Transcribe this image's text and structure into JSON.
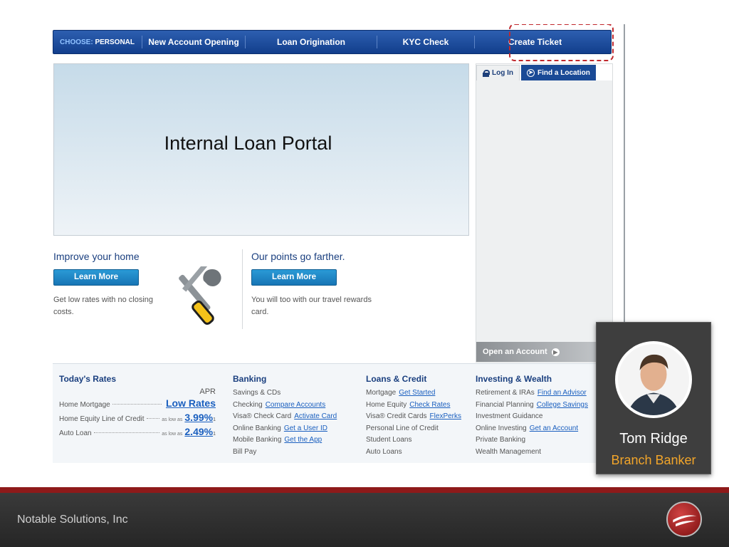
{
  "nav": {
    "choose_label": "CHOOSE:",
    "choose_value": "PERSONAL",
    "items": [
      "New Account Opening",
      "Loan Origination",
      "KYC Check",
      "Create Ticket"
    ]
  },
  "hero": {
    "title": "Internal Loan Portal"
  },
  "side": {
    "tab_login": "Log In",
    "tab_find": "Find a Location",
    "open_account": "Open an Account"
  },
  "promos": [
    {
      "title": "Improve your home",
      "button": "Learn More",
      "text": "Get low rates with no closing costs."
    },
    {
      "title": "Our points go farther.",
      "button": "Learn More",
      "text": "You will too with our travel rewards card."
    }
  ],
  "rates": {
    "title": "Today's Rates",
    "apr_label": "APR",
    "rows": [
      {
        "label": "Home Mortgage",
        "as_low_as": "",
        "value": "Low Rates",
        "sup": ""
      },
      {
        "label": "Home Equity Line of Credit",
        "as_low_as": "as low as",
        "value": "3.99%",
        "sup": "1"
      },
      {
        "label": "Auto Loan",
        "as_low_as": "as low as",
        "value": "2.49%",
        "sup": "1"
      }
    ]
  },
  "banking": {
    "title": "Banking",
    "rows": [
      {
        "label": "Savings & CDs",
        "link": ""
      },
      {
        "label": "Checking",
        "link": "Compare Accounts"
      },
      {
        "label": "Visa® Check Card",
        "link": "Activate Card"
      },
      {
        "label": "Online Banking",
        "link": "Get a User ID"
      },
      {
        "label": "Mobile Banking",
        "link": "Get the App"
      },
      {
        "label": "Bill Pay",
        "link": ""
      }
    ]
  },
  "loans": {
    "title": "Loans & Credit",
    "rows": [
      {
        "label": "Mortgage",
        "link": "Get Started"
      },
      {
        "label": "Home Equity",
        "link": "Check Rates"
      },
      {
        "label": "Visa® Credit Cards",
        "link": "FlexPerks"
      },
      {
        "label": "Personal Line of Credit",
        "link": ""
      },
      {
        "label": "Student Loans",
        "link": ""
      },
      {
        "label": "Auto Loans",
        "link": ""
      }
    ]
  },
  "investing": {
    "title": "Investing & Wealth",
    "rows": [
      {
        "label": "Retirement & IRAs",
        "link": "Find an Advisor"
      },
      {
        "label": "Financial Planning",
        "link": "College Savings"
      },
      {
        "label": "Investment Guidance",
        "link": ""
      },
      {
        "label": "Online Investing",
        "link": "Get an Account"
      },
      {
        "label": "Private Banking",
        "link": ""
      },
      {
        "label": "Wealth Management",
        "link": ""
      }
    ]
  },
  "persona": {
    "name": "Tom Ridge",
    "role": "Branch Banker"
  },
  "footer": {
    "company": "Notable Solutions, Inc"
  },
  "colors": {
    "accent": "#f2a52a",
    "highlight": "#c0282d",
    "nav": "#1a4a96",
    "footer_red": "#8e1a1a"
  }
}
